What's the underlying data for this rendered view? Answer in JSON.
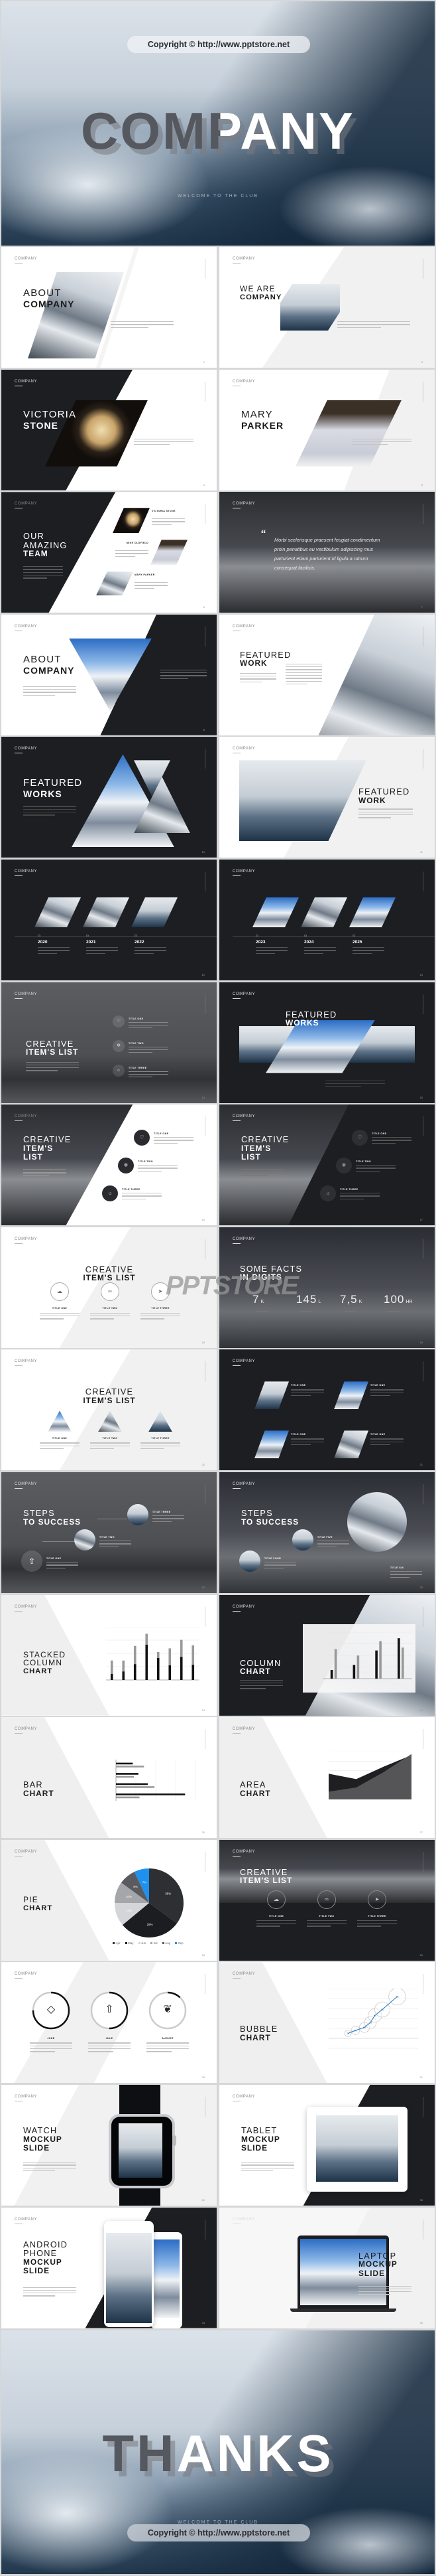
{
  "hero": {
    "copyright": "Copyright © http://www.pptstore.net",
    "title": "COMPANY",
    "subtitle": "WELCOME TO THE CLUB"
  },
  "brand_label": "COMPANY",
  "watermark": "PPTSTORE",
  "colors": {
    "dark": "#1d1e22",
    "light_gray": "#f1f1f1",
    "accent_blue": "#1e90f0",
    "text_dark": "#1a1a1a"
  },
  "slides": [
    {
      "template": "about",
      "page": "2",
      "title": {
        "light": [
          "ABOUT"
        ],
        "bold": [
          "COMPANY"
        ]
      }
    },
    {
      "template": "weare",
      "page": "3",
      "title": {
        "light": [
          "WE ARE"
        ],
        "bold": [
          "COMPANY"
        ]
      }
    },
    {
      "template": "person-dark",
      "page": "4",
      "title": {
        "light": [
          "VICTORIA"
        ],
        "bold": [
          "STONE"
        ]
      }
    },
    {
      "template": "person-light",
      "page": "5",
      "title": {
        "light": [
          "MARY"
        ],
        "bold": [
          "PARKER"
        ]
      }
    },
    {
      "template": "team",
      "page": "6",
      "title": {
        "light": [
          "OUR",
          "AMAZING"
        ],
        "bold": [
          "TEAM"
        ]
      },
      "members": [
        {
          "name": "VICTORIA STONE"
        },
        {
          "name": "MIKE OLDFIELD"
        },
        {
          "name": "MARY PARKER"
        }
      ]
    },
    {
      "template": "quote",
      "page": "7",
      "quote": "Morbi scelerisque praesent feugiat condimentum proin penatibus eu vestibulum adipiscing mus parturient etiam parturient id ligula a rutrum consequat facilisis.",
      "quote_mark": "“"
    },
    {
      "template": "about-tri",
      "page": "8",
      "title": {
        "light": [
          "ABOUT"
        ],
        "bold": [
          "COMPANY"
        ]
      }
    },
    {
      "template": "featured-right",
      "page": "9",
      "title": {
        "light": [
          "FEATURED"
        ],
        "bold": [
          "WORK"
        ]
      }
    },
    {
      "template": "featured-tri",
      "page": "10",
      "title": {
        "light": [
          "FEATURED"
        ],
        "bold": [
          "WORKS"
        ]
      }
    },
    {
      "template": "featured-left",
      "page": "11",
      "title": {
        "light": [
          "FEATURED"
        ],
        "bold": [
          "WORK"
        ]
      }
    },
    {
      "template": "timeline",
      "page": "12",
      "years": [
        "2020",
        "2021",
        "2022"
      ]
    },
    {
      "template": "timeline",
      "page": "13",
      "years": [
        "2023",
        "2024",
        "2025"
      ]
    },
    {
      "template": "items-gray",
      "page": "14",
      "title": {
        "light": [
          "CREATIVE"
        ],
        "bold": [
          "ITEM'S LIST"
        ]
      },
      "items": [
        {
          "label": "TITLE ONE",
          "icon": "heart-icon"
        },
        {
          "label": "TITLE TWO",
          "icon": "snowflake-icon"
        },
        {
          "label": "TITLE THREE",
          "icon": "sun-icon"
        }
      ]
    },
    {
      "template": "featured-banner",
      "page": "15",
      "title": {
        "light": [
          "FEATURED"
        ],
        "bold": [
          "WORKS"
        ]
      }
    },
    {
      "template": "items-split",
      "page": "16",
      "title": {
        "light": [
          "CREATIVE"
        ],
        "bold": [
          "ITEM'S",
          "LIST"
        ]
      },
      "items": [
        {
          "label": "TITLE ONE",
          "icon": "heart-icon"
        },
        {
          "label": "TITLE TWO",
          "icon": "snowflake-icon"
        },
        {
          "label": "TITLE THREE",
          "icon": "sun-icon"
        }
      ]
    },
    {
      "template": "items-split-dark",
      "page": "17",
      "title": {
        "light": [
          "CREATIVE"
        ],
        "bold": [
          "ITEM'S",
          "LIST"
        ]
      },
      "items": [
        {
          "label": "TITLE ONE",
          "icon": "heart-icon"
        },
        {
          "label": "TITLE TWO",
          "icon": "snowflake-icon"
        },
        {
          "label": "TITLE THREE",
          "icon": "sun-icon"
        }
      ]
    },
    {
      "template": "items-center",
      "page": "18",
      "title": {
        "light": [
          "CREATIVE"
        ],
        "bold": [
          "ITEM'S LIST"
        ]
      },
      "items": [
        {
          "label": "TITLE ONE",
          "icon": "cloud-icon"
        },
        {
          "label": "TITLE TWO",
          "icon": "infinity-icon"
        },
        {
          "label": "TITLE THREE",
          "icon": "send-icon"
        }
      ]
    },
    {
      "template": "facts",
      "page": "19",
      "title": {
        "light": [
          "SOME FACTS"
        ],
        "bold": [
          "IN DIGITS"
        ]
      },
      "facts": [
        {
          "value": "7",
          "unit": "K"
        },
        {
          "value": "145",
          "unit": "L"
        },
        {
          "value": "7,5",
          "unit": "K"
        },
        {
          "value": "100",
          "unit": "HR"
        }
      ]
    },
    {
      "template": "items-tri",
      "page": "20",
      "title": {
        "light": [
          "CREATIVE"
        ],
        "bold": [
          "ITEM'S LIST"
        ]
      },
      "items": [
        {
          "label": "TITLE ONE"
        },
        {
          "label": "TITLE TWO"
        },
        {
          "label": "TITLE THREE"
        }
      ]
    },
    {
      "template": "four-items",
      "page": "21",
      "items": [
        {
          "label": "TITLE ONE"
        },
        {
          "label": "TITLE ONE"
        },
        {
          "label": "TITLE ONE"
        },
        {
          "label": "TITLE ONE"
        }
      ]
    },
    {
      "template": "steps",
      "page": "22",
      "title": {
        "light": [
          "STEPS"
        ],
        "bold": [
          "TO SUCCESS"
        ]
      },
      "items": [
        {
          "label": "TITLE ONE"
        },
        {
          "label": "TITLE TWO"
        },
        {
          "label": "TITLE THREE"
        }
      ]
    },
    {
      "template": "steps2",
      "page": "23",
      "title": {
        "light": [
          "STEPS"
        ],
        "bold": [
          "TO SUCCESS"
        ]
      },
      "items": [
        {
          "label": "TITLE FOUR"
        },
        {
          "label": "TITLE FIVE"
        },
        {
          "label": "TITLE SIX"
        }
      ]
    },
    {
      "template": "stacked",
      "page": "24",
      "title": {
        "light": [
          "STACKED",
          "COLUMN"
        ],
        "bold": [
          "CHART"
        ]
      },
      "chart": {
        "type": "bar",
        "stacked": true,
        "series": [
          {
            "values": [
              1.0,
              1.4,
              2.6,
              5.8,
              3.6,
              2.4,
              3.8,
              2.5
            ]
          },
          {
            "values": [
              2.2,
              1.8,
              3.0,
              1.8,
              1.0,
              2.8,
              2.8,
              3.2
            ]
          }
        ],
        "colors": [
          "#111111",
          "#999999"
        ]
      }
    },
    {
      "template": "column",
      "page": "25",
      "title": {
        "light": [
          "COLUMN"
        ],
        "bold": [
          "CHART"
        ]
      },
      "chart": {
        "type": "bar",
        "series": [
          {
            "values": [
              1.2,
              1.9,
              3.9,
              5.6
            ]
          },
          {
            "values": [
              4.1,
              3.2,
              5.2,
              4.3
            ]
          }
        ],
        "colors": [
          "#111111",
          "#999999"
        ]
      }
    },
    {
      "template": "barh",
      "page": "26",
      "title": {
        "light": [
          "BAR"
        ],
        "bold": [
          "CHART"
        ]
      },
      "chart": {
        "type": "bar",
        "orientation": "horizontal",
        "series": [
          {
            "values": [
              4.5,
              6.0,
              8.5,
              18.5
            ]
          },
          {
            "values": [
              7.5,
              4.8,
              10.3,
              6.3
            ]
          }
        ],
        "colors": [
          "#111111",
          "#999999"
        ]
      }
    },
    {
      "template": "area",
      "page": "27",
      "title": {
        "light": [
          "AREA"
        ],
        "bold": [
          "CHART"
        ]
      },
      "chart": {
        "type": "area",
        "series": [
          {
            "values": [
              4.3,
              3.4,
              5.5,
              7.4
            ]
          },
          {
            "values": [
              1.3,
              2.0,
              4.6,
              7.6
            ]
          }
        ],
        "colors": [
          "#1f1f22",
          "#555558"
        ]
      }
    },
    {
      "template": "pie",
      "page": "28",
      "title": {
        "light": [
          "PIE"
        ],
        "bold": [
          "CHART"
        ]
      },
      "chart": {
        "type": "pie",
        "categories": [
          "Apr",
          "May",
          "Jun",
          "Jul",
          "Aug",
          "Sep"
        ],
        "values": [
          35,
          29,
          11,
          10,
          8,
          7
        ],
        "labels": [
          "35%",
          "29%",
          "11%",
          "10%",
          "8%",
          "7%"
        ],
        "colors": [
          "#2e2f33",
          "#1c1d20",
          "#d4d5d8",
          "#a5a6a9",
          "#5a5b5f",
          "#1e90f0"
        ]
      }
    },
    {
      "template": "items-dark-top",
      "page": "29",
      "title": {
        "light": [
          "CREATIVE"
        ],
        "bold": [
          "ITEM'S LIST"
        ]
      },
      "items": [
        {
          "label": "TITLE ONE",
          "icon": "cloud-icon"
        },
        {
          "label": "TITLE TWO",
          "icon": "infinity-icon"
        },
        {
          "label": "TITLE THREE",
          "icon": "send-icon"
        }
      ]
    },
    {
      "template": "rings",
      "page": "30",
      "items": [
        {
          "label": "JUNE",
          "icon": "diamond-icon",
          "progress": 0.75
        },
        {
          "label": "JULE",
          "icon": "rocket-icon",
          "progress": 0.5
        },
        {
          "label": "AUGUST",
          "icon": "leaf-icon",
          "progress": 0.12
        }
      ]
    },
    {
      "template": "bubble",
      "page": "31",
      "title": {
        "light": [
          "BUBBLE"
        ],
        "bold": [
          "CHART"
        ]
      },
      "chart": {
        "type": "scatter",
        "x": [
          1.3,
          1.8,
          2.4,
          2.8,
          3.1,
          3.6,
          4.6
        ],
        "y": [
          0.9,
          1.2,
          1.5,
          2.0,
          2.7,
          3.3,
          4.6
        ],
        "labels": [
          "25",
          "30",
          "50",
          "75",
          "85",
          "60",
          "35"
        ]
      }
    },
    {
      "template": "watch",
      "page": "32",
      "title": {
        "light": [
          "WATCH"
        ],
        "bold": [
          "MOCKUP",
          "SLIDE"
        ]
      }
    },
    {
      "template": "tablet",
      "page": "33",
      "title": {
        "light": [
          "TABLET"
        ],
        "bold": [
          "MOCKUP",
          "SLIDE"
        ]
      }
    },
    {
      "template": "android",
      "page": "34",
      "title": {
        "light": [
          "ANDROID",
          "PHONE"
        ],
        "bold": [
          "MOCKUP",
          "SLIDE"
        ]
      }
    },
    {
      "template": "laptop",
      "page": "35",
      "title": {
        "light": [
          "LAPTOP"
        ],
        "bold": [
          "MOCKUP",
          "SLIDE"
        ]
      }
    }
  ],
  "thanks": {
    "title": "THANKS",
    "subtitle": "WELCOME TO THE CLUB",
    "copyright": "Copyright © http://www.pptstore.net"
  }
}
